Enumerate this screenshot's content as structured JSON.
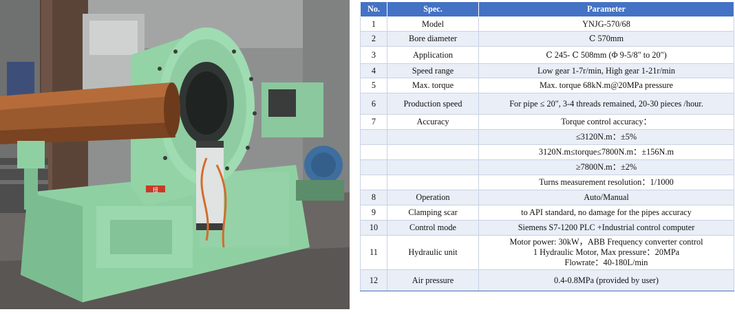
{
  "photo": {
    "sign_text": "扭"
  },
  "table": {
    "headers": [
      "No.",
      "Spec.",
      "Parameter"
    ],
    "rows": [
      {
        "no": "1",
        "spec": "Model",
        "param": [
          "YNJG-570/68"
        ]
      },
      {
        "no": "2",
        "spec": "Bore diameter",
        "param": [
          "Ⅽ 570mm"
        ]
      },
      {
        "no": "3",
        "spec": "Application",
        "param": [
          "Ⅽ 245- Ⅽ 508mm (Φ 9-5/8\" to 20\")"
        ]
      },
      {
        "no": "4",
        "spec": "Speed range",
        "param": [
          "Low gear 1-7r/min, High gear 1-21r/min"
        ]
      },
      {
        "no": "5",
        "spec": "Max. torque",
        "param": [
          "Max. torque 68kN.m@20MPa pressure"
        ]
      },
      {
        "no": "6",
        "spec": "Production speed",
        "param": [
          "For pipe ≤ 20\", 3-4 threads remained, 20-30 pieces /hour."
        ]
      },
      {
        "no": "7",
        "spec": "Accuracy",
        "param": [
          "Torque control accuracy："
        ]
      },
      {
        "no": "",
        "spec": "",
        "param": [
          "≤3120N.m：±5%"
        ]
      },
      {
        "no": "",
        "spec": "",
        "param": [
          "3120N.m≤torque≤7800N.m：±156N.m"
        ]
      },
      {
        "no": "",
        "spec": "",
        "param": [
          "≥7800N.m：±2%"
        ]
      },
      {
        "no": "",
        "spec": "",
        "param": [
          "Turns measurement resolution：1/1000"
        ]
      },
      {
        "no": "8",
        "spec": "Operation",
        "param": [
          "Auto/Manual"
        ]
      },
      {
        "no": "9",
        "spec": "Clamping scar",
        "param": [
          "to API standard,  no damage for the pipes accuracy"
        ]
      },
      {
        "no": "10",
        "spec": "Control mode",
        "param": [
          "Siemens S7-1200 PLC +Industrial control computer"
        ]
      },
      {
        "no": "11",
        "spec": "Hydraulic unit",
        "param": [
          "Motor power: 30kW，ABB Frequency converter control",
          "1 Hydraulic Motor, Max pressure：20MPa",
          "Flowrate：40-180L/min"
        ]
      },
      {
        "no": "12",
        "spec": "Air pressure",
        "param": [
          "0.4-0.8MPa (provided by user)"
        ]
      }
    ]
  }
}
